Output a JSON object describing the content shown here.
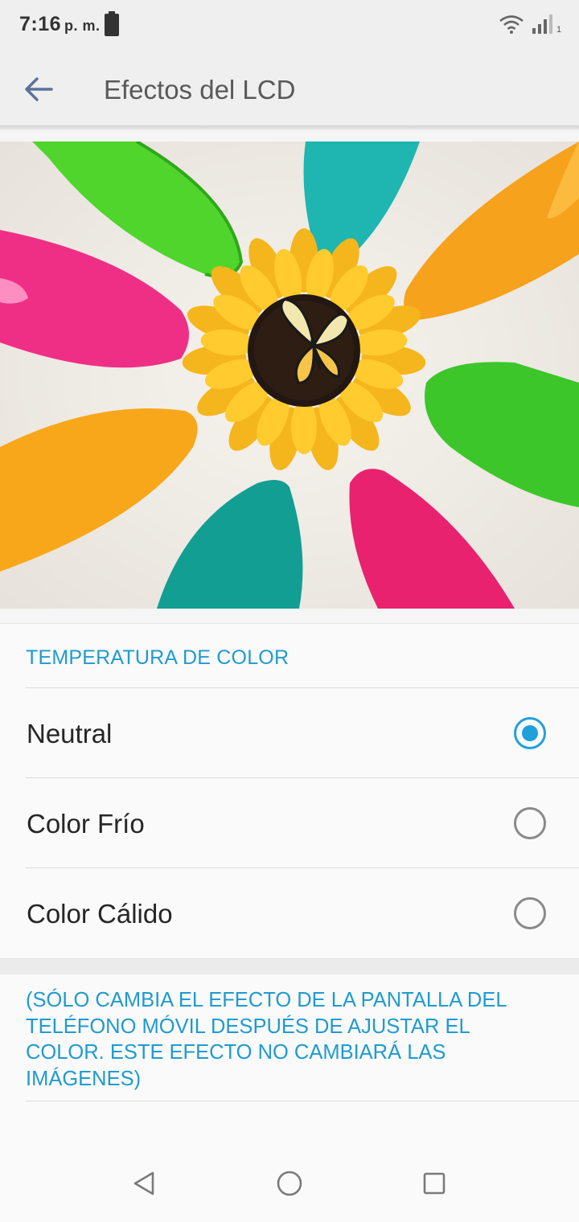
{
  "status_bar": {
    "time": "7:16",
    "ampm": "p. m.",
    "sim_number": "1",
    "icons": [
      "battery-icon",
      "wifi-icon",
      "signal-icon"
    ]
  },
  "app_bar": {
    "title": "Efectos del LCD",
    "back_icon": "back-arrow-icon"
  },
  "preview_image": {
    "description_icon": "sunflower-butterfly-preview"
  },
  "color_temperature": {
    "header": "TEMPERATURA DE COLOR",
    "options": [
      {
        "label": "Neutral",
        "selected": true
      },
      {
        "label": "Color Frío",
        "selected": false
      },
      {
        "label": "Color Cálido",
        "selected": false
      }
    ]
  },
  "note": {
    "text": "(SÓLO CAMBIA EL EFECTO DE LA PANTALLA DEL TELÉFONO MÓVIL DESPUÉS DE AJUSTAR EL COLOR. ESTE EFECTO NO CAMBIARÁ LAS IMÁGENES)"
  },
  "nav_bar": {
    "icons": [
      "nav-back-icon",
      "nav-home-icon",
      "nav-recents-icon"
    ]
  },
  "colors": {
    "accent": "#1f9bcf",
    "radio_selected": "#1fa0dd",
    "app_bar_bg": "#efefef"
  }
}
